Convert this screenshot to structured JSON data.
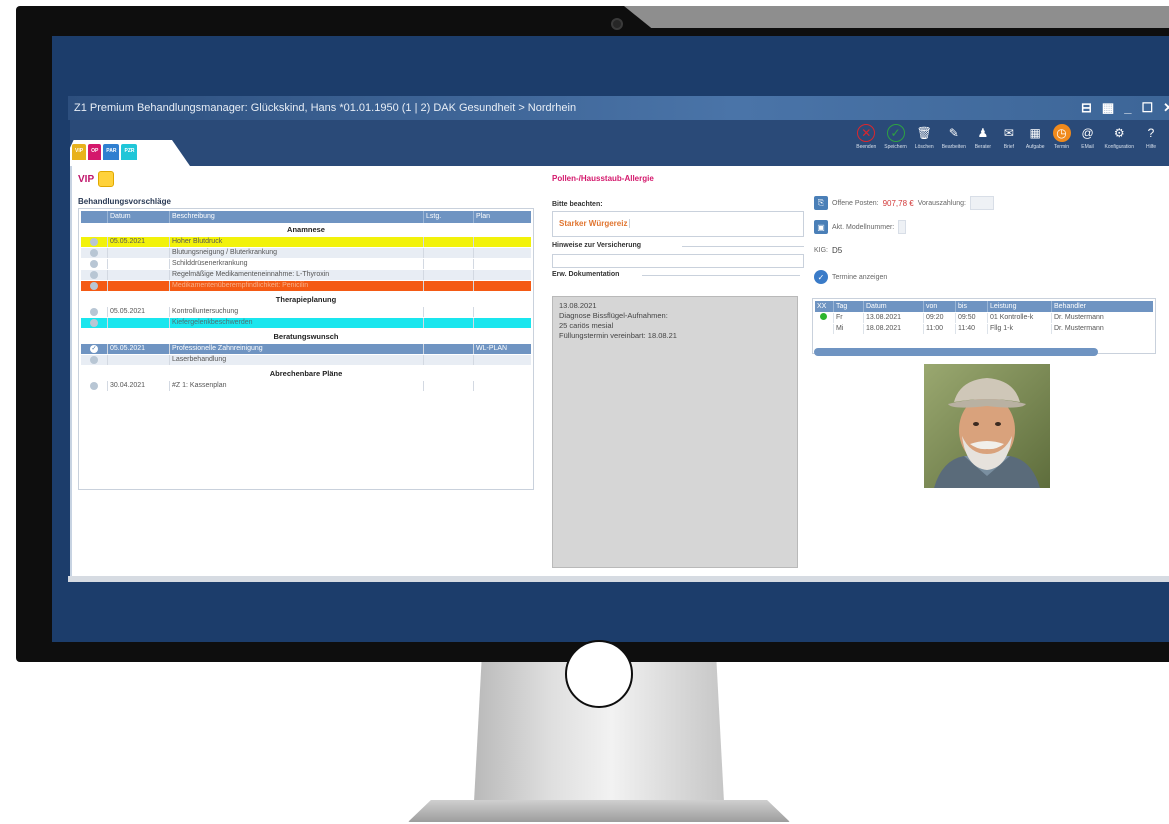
{
  "window": {
    "title": "Z1 Premium Behandlungsmanager: Glückskind, Hans *01.01.1950 (1 | 2) DAK Gesundheit > Nordrhein",
    "controls": [
      "⊟",
      "▦",
      "_",
      "☐",
      "✕"
    ]
  },
  "toolbar": [
    {
      "label": "Beenden",
      "icon": "close-circle-icon",
      "color": "#d9272e"
    },
    {
      "label": "Speichern",
      "icon": "check-circle-icon",
      "color": "#2ea043"
    },
    {
      "label": "Löschen",
      "icon": "trash-icon",
      "color": "#ffffff"
    },
    {
      "label": "Bearbeiten",
      "icon": "pencil-icon",
      "color": "#ffffff"
    },
    {
      "label": "Berater",
      "icon": "user-gear-icon",
      "color": "#ffffff"
    },
    {
      "label": "Brief",
      "icon": "envelope-icon",
      "color": "#ffffff"
    },
    {
      "label": "Aufgabe",
      "icon": "calendar-icon",
      "color": "#ffffff"
    },
    {
      "label": "Termin",
      "icon": "clock-icon",
      "color": "#f08a1c"
    },
    {
      "label": "EMail",
      "icon": "at-icon",
      "color": "#ffffff"
    },
    {
      "label": "Konfiguration",
      "icon": "gear-icon",
      "color": "#ffffff"
    },
    {
      "label": "Hilfe",
      "icon": "question-icon",
      "color": "#ffffff"
    }
  ],
  "tabs": [
    {
      "label": "VIP",
      "color": "#e8b21d"
    },
    {
      "label": "OP",
      "color": "#d4186c"
    },
    {
      "label": "PAR",
      "color": "#2f7fd0"
    },
    {
      "label": "PZR",
      "color": "#1fc6d8"
    }
  ],
  "vip_label": "VIP",
  "suggestions": {
    "caption": "Behandlungsvorschläge",
    "columns": [
      "Datum",
      "Beschreibung",
      "Lstg.",
      "Plan"
    ],
    "groups": [
      {
        "title": "Anamnese",
        "rows": [
          {
            "date": "05.05.2021",
            "desc": "Hoher Blutdruck",
            "lstg": "",
            "plan": "",
            "bg": "#f2f20a",
            "fg": "#555",
            "check": false
          },
          {
            "date": "",
            "desc": "Blutungsneigung / Bluterkrankung",
            "lstg": "",
            "plan": "",
            "bg": "#e8edf4",
            "fg": "#555",
            "check": false
          },
          {
            "date": "",
            "desc": "Schilddrüsenerkrankung",
            "lstg": "",
            "plan": "",
            "bg": "#ffffff",
            "fg": "#555",
            "check": false
          },
          {
            "date": "",
            "desc": "Regelmäßige Medikamenteneinnahme: L-Thyroxin",
            "lstg": "",
            "plan": "",
            "bg": "#e8edf4",
            "fg": "#555",
            "check": false
          },
          {
            "date": "",
            "desc": "Medikamentenüberempfindlichkeit: Penicilin",
            "lstg": "",
            "plan": "",
            "bg": "#f45a14",
            "fg": "#f7b08a",
            "check": false
          }
        ]
      },
      {
        "title": "Therapieplanung",
        "rows": [
          {
            "date": "05.05.2021",
            "desc": "Kontrolluntersuchung",
            "lstg": "",
            "plan": "",
            "bg": "#ffffff",
            "fg": "#555",
            "check": false
          },
          {
            "date": "",
            "desc": "Kiefergelenkbeschwerden",
            "lstg": "",
            "plan": "",
            "bg": "#1ae6ee",
            "fg": "#4d6f73",
            "check": false
          }
        ]
      },
      {
        "title": "Beratungswunsch",
        "rows": [
          {
            "date": "05.05.2021",
            "desc": "Professionelle Zahnreinigung",
            "lstg": "",
            "plan": "WL-PLAN",
            "bg": "#6f94c2",
            "fg": "#ffffff",
            "check": true
          },
          {
            "date": "",
            "desc": "Laserbehandlung",
            "lstg": "",
            "plan": "",
            "bg": "#e8edf4",
            "fg": "#555",
            "check": false
          }
        ]
      },
      {
        "title": "Abrechenbare Pläne",
        "rows": [
          {
            "date": "30.04.2021",
            "desc": "#Z   1: Kassenplan",
            "lstg": "",
            "plan": "",
            "bg": "#ffffff",
            "fg": "#555",
            "check": false
          }
        ]
      }
    ]
  },
  "middle": {
    "allergy": "Pollen-/Hausstaub-Allergie",
    "note_caption": "Bitte beachten:",
    "note_text": "Starker Würgereiz",
    "insurance_caption": "Hinweise zur Versicherung",
    "doc_caption": "Erw. Dokumentation",
    "doc_lines": [
      "13.08.2021",
      "Diagnose Bissflügel-Aufnahmen:",
      "25 cariös mesial",
      "Füllungstermin vereinbart: 18.08.21"
    ]
  },
  "right": {
    "open_items_label": "Offene Posten:",
    "open_items_value": "907,78 €",
    "prepay_label": "Vorauszahlung:",
    "model_label": "Akt. Modellnummer:",
    "kig_label": "KIG:",
    "kig_value": "D5",
    "appointments_toggle": "Termine anzeigen",
    "appt_columns": [
      "XX",
      "Tag",
      "Datum",
      "von",
      "bis",
      "Leistung",
      "Behandler"
    ],
    "appointments": [
      {
        "status": "green",
        "day": "Fr",
        "date": "13.08.2021",
        "from": "09:20",
        "to": "09:50",
        "service": "01 Kontrolle-k",
        "doctor": "Dr. Mustermann"
      },
      {
        "status": "",
        "day": "Mi",
        "date": "18.08.2021",
        "from": "11:00",
        "to": "11:40",
        "service": "Fllg 1-k",
        "doctor": "Dr. Mustermann"
      }
    ]
  },
  "colors": {
    "accent": "#6f94c2",
    "magenta": "#d4186c",
    "warning_orange": "#e07530",
    "price_red": "#d33a3a"
  }
}
